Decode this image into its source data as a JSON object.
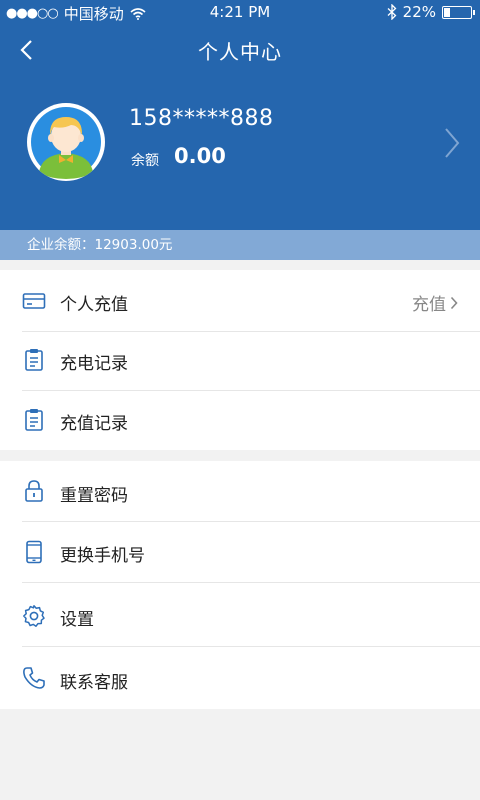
{
  "status_bar": {
    "carrier": "中国移动",
    "time": "4:21 PM",
    "battery": "22%",
    "battery_level": 0.22
  },
  "nav": {
    "title": "个人中心"
  },
  "profile": {
    "phone": "158*****888",
    "balance_label": "余额",
    "balance_value": "0.00"
  },
  "company_balance": "企业余额：12903.00元",
  "menu_group_1": [
    {
      "label": "个人充值",
      "icon": "card-icon",
      "right_label": "充值"
    },
    {
      "label": "充电记录",
      "icon": "clipboard-icon"
    },
    {
      "label": "充值记录",
      "icon": "clipboard-icon"
    }
  ],
  "menu_group_2": [
    {
      "label": "重置密码",
      "icon": "lock-icon"
    },
    {
      "label": "更换手机号",
      "icon": "mobile-phone-icon"
    },
    {
      "label": "设置",
      "icon": "gear-icon"
    },
    {
      "label": "联系客服",
      "icon": "phone-icon"
    }
  ],
  "colors": {
    "header": "#2566ae",
    "company_bar": "#82a9d6",
    "icon": "#2e6fb8",
    "background": "#f2f2f2"
  }
}
